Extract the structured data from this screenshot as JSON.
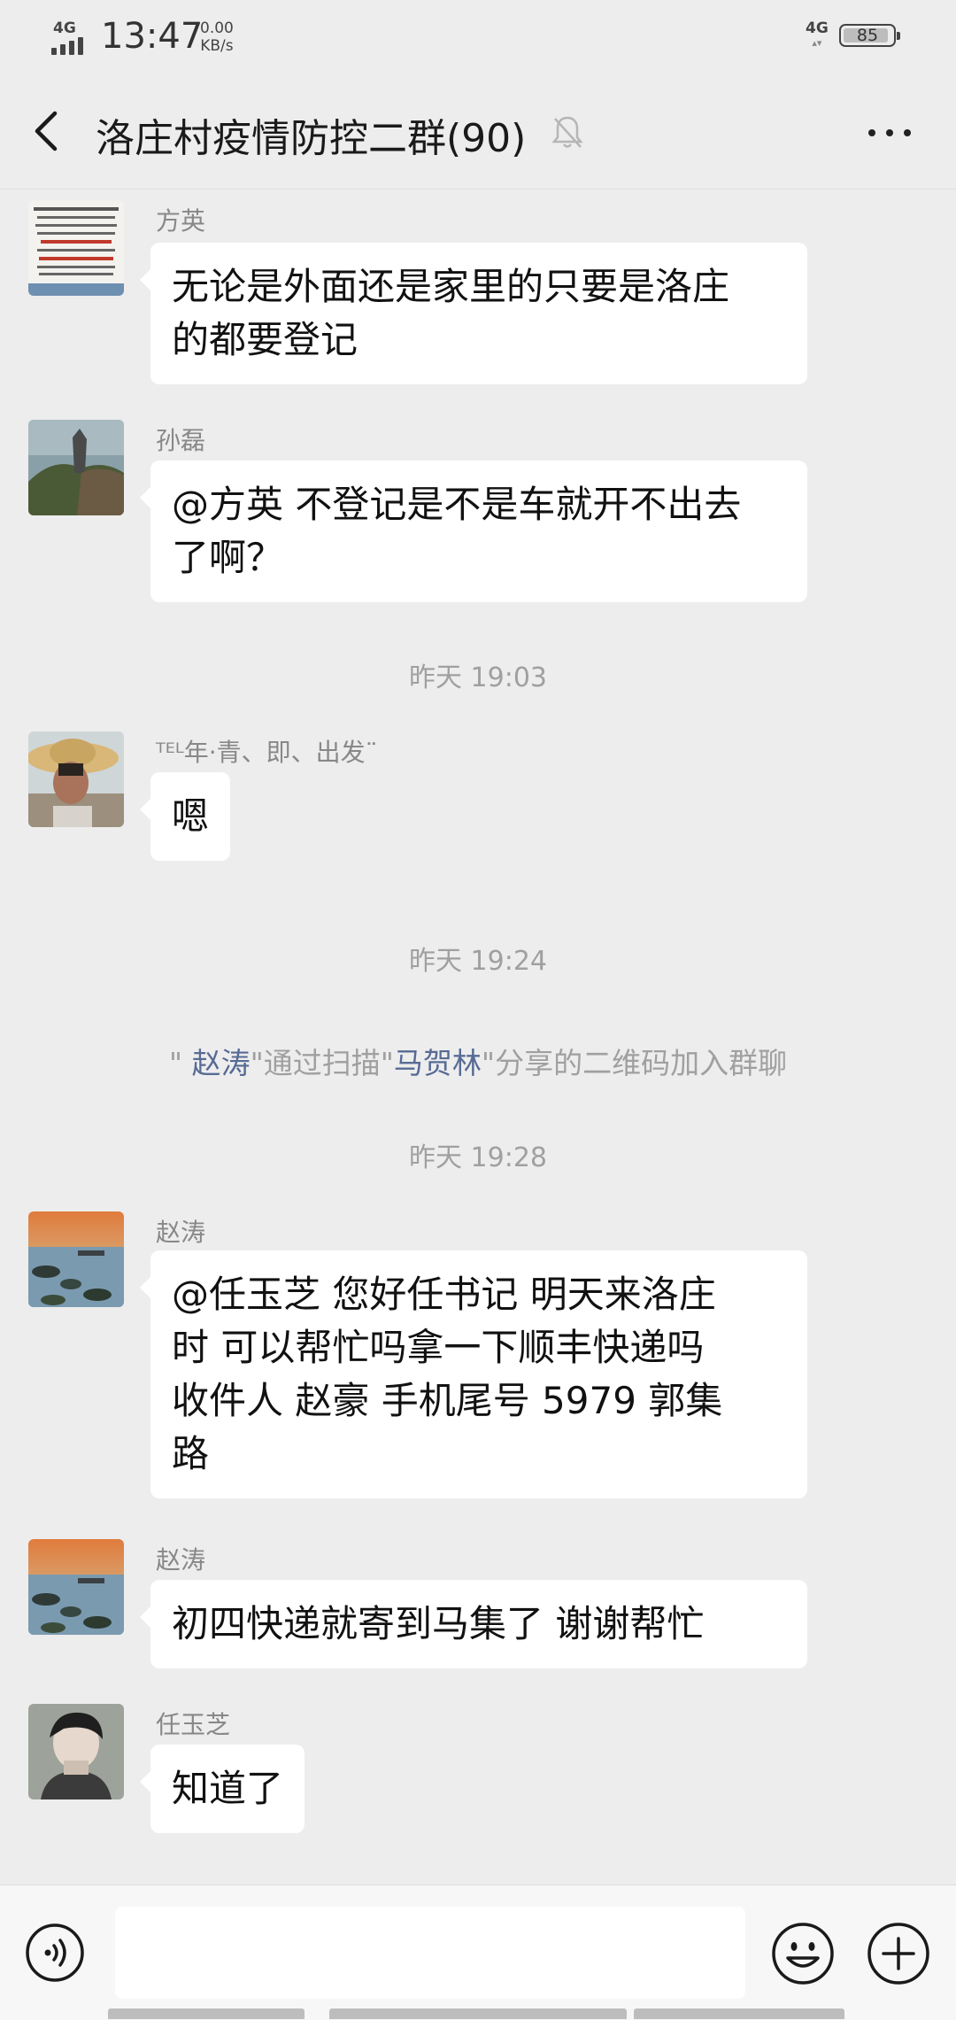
{
  "status_bar": {
    "network": "4G",
    "time": "13:47",
    "speed_value": "0.00",
    "speed_unit": "KB/s",
    "right_network": "4G",
    "battery": "85"
  },
  "header": {
    "title": "洛庄村疫情防控二群(90)",
    "back_icon": "chevron-left-icon",
    "mute_icon": "bell-muted-icon",
    "more_icon": "more-dots-icon"
  },
  "messages": [
    {
      "sender": "方英",
      "lines": [
        "无论是外面还是家里的只要是洛庄",
        "的都要登记"
      ]
    },
    {
      "sender": "孙磊",
      "lines": [
        "@方英  不登记是不是车就开不出去",
        "了啊？"
      ]
    },
    {
      "timestamp": "昨天 19:03"
    },
    {
      "sender": "ᵀᴱᴸ年·青、即、出发¨",
      "lines": [
        "嗯"
      ]
    },
    {
      "timestamp": "昨天 19:24"
    },
    {
      "system": {
        "prefix": "\" ",
        "user": "赵涛",
        "mid": "\"通过扫描\"",
        "inviter": "马贺林",
        "suffix": "\"分享的二维码加入群聊"
      }
    },
    {
      "timestamp": "昨天 19:28"
    },
    {
      "sender": "赵涛",
      "lines": [
        "@任玉芝  您好任书记 明天来洛庄",
        "时 可以帮忙吗拿一下顺丰快递吗",
        "收件人 赵豪  手机尾号 5979   郭集",
        "路"
      ]
    },
    {
      "sender": "赵涛",
      "lines": [
        "初四快递就寄到马集了   谢谢帮忙"
      ]
    },
    {
      "sender": "任玉芝",
      "lines": [
        "知道了"
      ]
    }
  ],
  "input_bar": {
    "voice_icon": "voice-icon",
    "emoji_icon": "emoji-icon",
    "plus_icon": "plus-icon"
  }
}
